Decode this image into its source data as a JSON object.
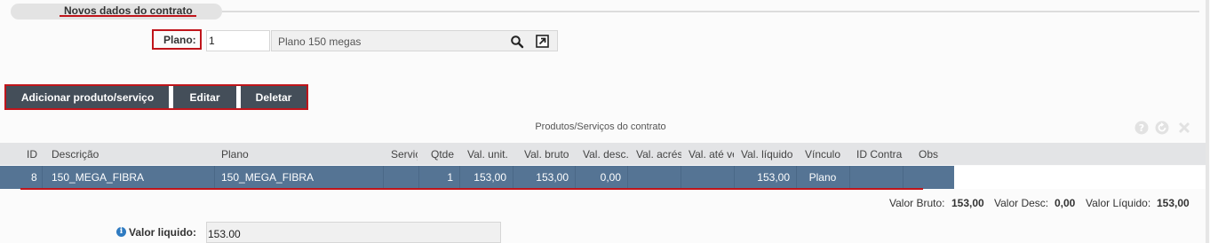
{
  "section": {
    "title": "Novos dados do contrato"
  },
  "plano": {
    "label": "Plano:",
    "id_value": "1",
    "description": "Plano 150 megas",
    "search_icon": "search-icon",
    "open_icon": "open-external-icon"
  },
  "toolbar": {
    "add_label": "Adicionar produto/serviço",
    "edit_label": "Editar",
    "delete_label": "Deletar"
  },
  "grid": {
    "caption": "Produtos/Serviços do contrato",
    "icons": [
      "help-icon",
      "refresh-icon",
      "close-icon"
    ],
    "columns": [
      "ID",
      "Descrição",
      "Plano",
      "Serviço",
      "Qtde",
      "Val. unit.",
      "Val. bruto",
      "Val. desc.",
      "Val. acrés",
      "Val. até ve",
      "Val. líquido",
      "Vínculo",
      "ID Contra",
      "Obs"
    ],
    "rows": [
      {
        "id": "8",
        "descricao": "150_MEGA_FIBRA",
        "plano": "150_MEGA_FIBRA",
        "servico": "",
        "qtde": "1",
        "val_unit": "153,00",
        "val_bruto": "153,00",
        "val_desc": "0,00",
        "val_acres": "",
        "val_ate_venc": "",
        "val_liquido": "153,00",
        "vinculo": "Plano",
        "id_contrato": "",
        "obs": ""
      }
    ],
    "selected_row_color": "#557494"
  },
  "totals": {
    "bruto_label": "Valor Bruto:",
    "bruto_value": "153,00",
    "desc_label": "Valor Desc:",
    "desc_value": "0,00",
    "liquido_label": "Valor Líquido:",
    "liquido_value": "153,00"
  },
  "valor_liquido": {
    "label": "Valor liquido:",
    "value": "153.00",
    "info_icon": "info-icon"
  },
  "colors": {
    "accent_red": "#c0151b",
    "toolbar_bg": "#444e59"
  }
}
